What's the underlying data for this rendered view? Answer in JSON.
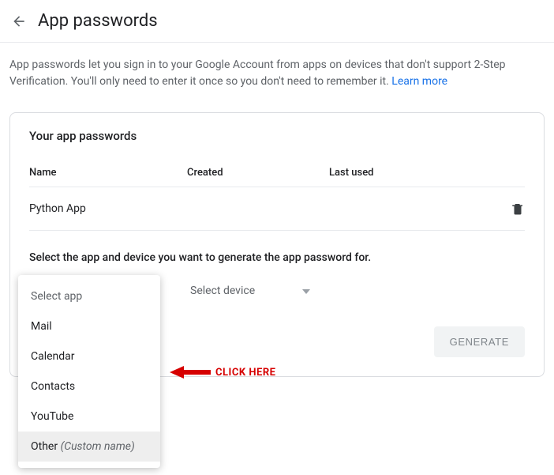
{
  "header": {
    "title": "App passwords"
  },
  "description": {
    "text": "App passwords let you sign in to your Google Account from apps on devices that don't support 2-Step Verification. You'll only need to enter it once so you don't need to remember it. ",
    "learn_more": "Learn more"
  },
  "card": {
    "heading": "Your app passwords",
    "columns": {
      "name": "Name",
      "created": "Created",
      "last_used": "Last used"
    },
    "rows": [
      {
        "name": "Python App",
        "created": "",
        "last_used": ""
      }
    ],
    "select_instruction": "Select the app and device you want to generate the app password for.",
    "app_dropdown": {
      "placeholder": "Select app",
      "options": [
        {
          "label": "Mail",
          "suffix": ""
        },
        {
          "label": "Calendar",
          "suffix": ""
        },
        {
          "label": "Contacts",
          "suffix": ""
        },
        {
          "label": "YouTube",
          "suffix": ""
        },
        {
          "label": "Other ",
          "suffix": "(Custom name)"
        }
      ]
    },
    "device_dropdown": {
      "placeholder": "Select device"
    },
    "generate_label": "GENERATE"
  },
  "annotation": {
    "text": "CLICK HERE"
  }
}
